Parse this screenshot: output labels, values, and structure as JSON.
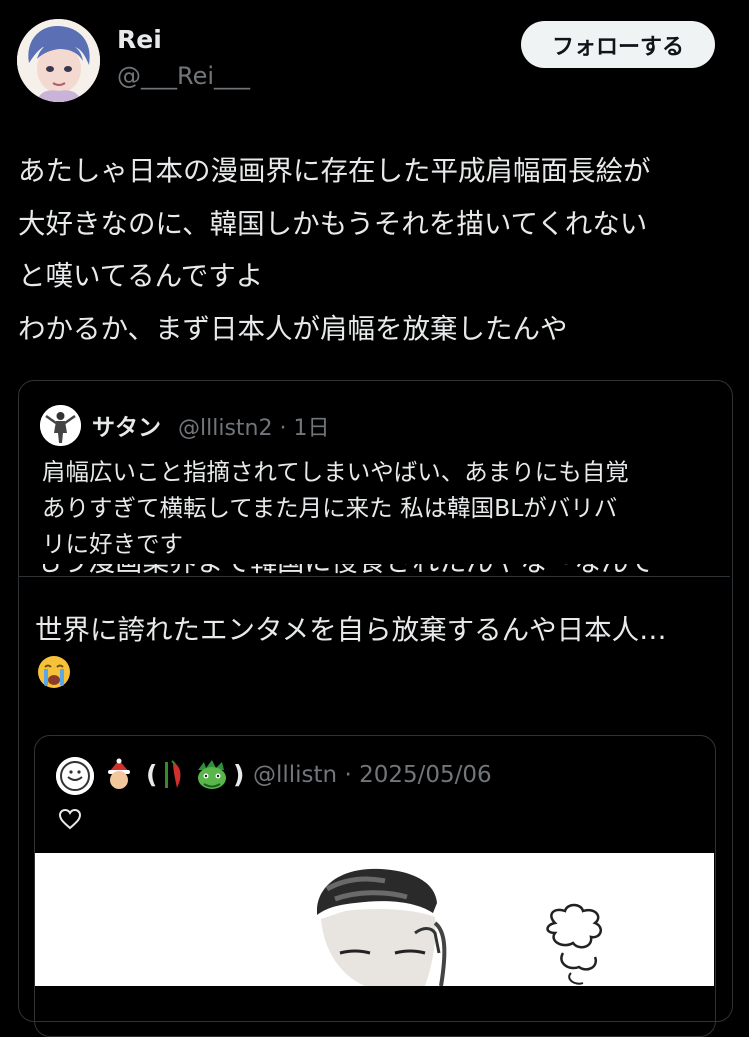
{
  "post": {
    "display_name": "Rei",
    "handle": "@___Rei___",
    "follow_label": "フォローする",
    "body": "あたしゃ日本の漫画界に存在した平成肩幅面長絵が\n大好きなのに、韓国しかもうそれを描いてくれない\nと嘆いてるんですよ\nわかるか、まず日本人が肩幅を放棄したんや"
  },
  "quote": {
    "display_name": "サタン",
    "meta": "@lllistn2 · 1日",
    "text": "肩幅広いこと指摘されてしまいやばい、あまりにも自覚\nありすぎて横転してまた月に来た 私は韓国BLがバリバ\nリに好きです",
    "clipped_line": "もう漫画業界まで韓国に侵食されたんやな〜なんで",
    "text_continued": "世界に誇れたエンタメを自ら放棄するんや日本人…",
    "emoji_icon": "crying-face-emoji"
  },
  "nested_quote": {
    "paren_open": "(",
    "paren_close": ")",
    "meta": "@lllistn · 2025/05/06",
    "icons": [
      "santa-emoji",
      "chili-emoji",
      "dragon-emoji",
      "heart-icon"
    ]
  },
  "colors": {
    "background": "#000000",
    "text": "#e7e9ea",
    "muted": "#71767b",
    "border": "#2f3336",
    "follow_bg": "#eff3f4"
  }
}
